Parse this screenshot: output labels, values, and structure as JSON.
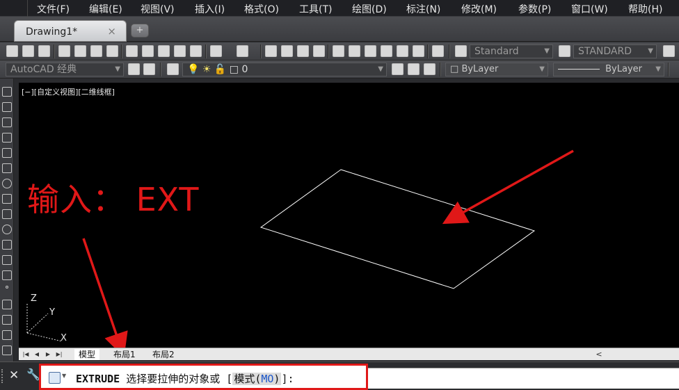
{
  "menubar": {
    "items": [
      "文件(F)",
      "编辑(E)",
      "视图(V)",
      "插入(I)",
      "格式(O)",
      "工具(T)",
      "绘图(D)",
      "标注(N)",
      "修改(M)",
      "参数(P)",
      "窗口(W)",
      "帮助(H)"
    ]
  },
  "tabs": {
    "document_tab": "Drawing1*",
    "close_glyph": "×",
    "new_tab_glyph": "+"
  },
  "toolbar1": {
    "text_style": "Standard",
    "dim_style": "STANDARD"
  },
  "toolbar2": {
    "workspace": "AutoCAD 经典",
    "layer": "0",
    "color": "ByLayer",
    "linetype": "ByLayer"
  },
  "drawing": {
    "view_label": "[−][自定义视图][二维线框]",
    "annotation": "输入： EXT",
    "ucs_labels": {
      "z": "Z",
      "y": "Y",
      "x": "X"
    },
    "colors": {
      "background": "#000000",
      "annotation": "#e01818",
      "geometry": "#ffffff"
    }
  },
  "layout_tabs": {
    "items": [
      "模型",
      "布局1",
      "布局2"
    ],
    "active": "模型",
    "scroll_left_glyph": "<"
  },
  "command": {
    "close_glyph": "✕",
    "name": "EXTRUDE",
    "prompt": "选择要拉伸的对象或 [",
    "option_label": "模式(",
    "option_key": "MO",
    "option_close": ")",
    "suffix": "]:"
  }
}
